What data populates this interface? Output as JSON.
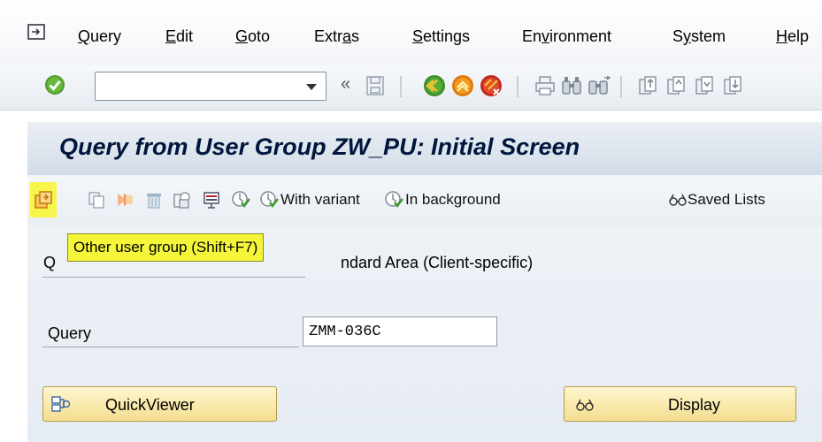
{
  "menubar": {
    "items": [
      {
        "label": "Query",
        "underline": "Q"
      },
      {
        "label": "Edit",
        "underline": "E"
      },
      {
        "label": "Goto",
        "underline": "G"
      },
      {
        "label": "Extras",
        "underline": "a"
      },
      {
        "label": "Settings",
        "underline": "S"
      },
      {
        "label": "Environment",
        "underline": "v"
      },
      {
        "label": "System",
        "underline": "y"
      },
      {
        "label": "Help",
        "underline": "H"
      }
    ]
  },
  "toolbar": {
    "command_field_value": "",
    "icons": [
      "enter-check-icon",
      "history-back-icon",
      "save-icon",
      "back-icon",
      "exit-icon",
      "cancel-icon",
      "print-icon",
      "find-icon",
      "find-next-icon",
      "first-page-icon",
      "previous-page-icon",
      "next-page-icon",
      "last-page-icon"
    ]
  },
  "title": "Query from User Group ZW_PU: Initial Screen",
  "app_toolbar": {
    "with_variant_label": "With variant",
    "in_background_label": "In background",
    "saved_lists_label": "Saved Lists"
  },
  "tooltip": "Other user group   (Shift+F7)",
  "content": {
    "area_label_start": "Q",
    "area_label_end": "ndard Area (Client-specific)",
    "query_label": "Query",
    "query_value": "ZMM-036C",
    "quickviewer_label": "QuickViewer",
    "display_label": "Display"
  },
  "colors": {
    "highlight": "#f5f53a",
    "title_text": "#00163d",
    "button_bg": "#f3de8f"
  }
}
